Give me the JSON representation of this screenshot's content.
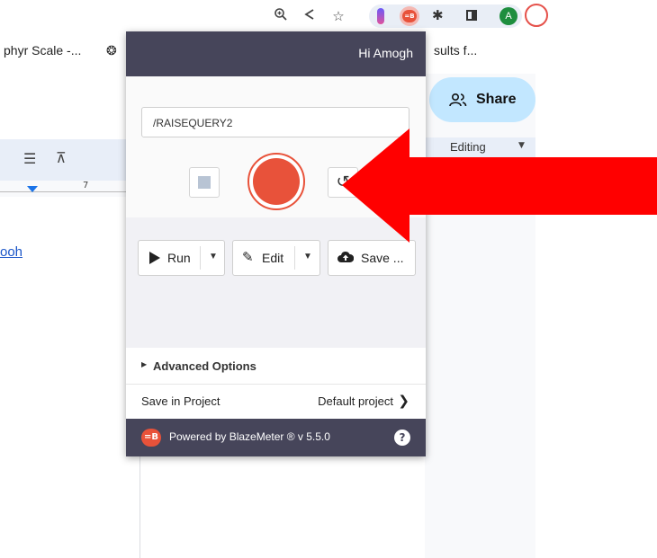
{
  "browser": {
    "icons": [
      "zoom-icon",
      "share-icon",
      "star-icon",
      "extension-icon",
      "blazemeter-extension-icon",
      "puzzle-icon",
      "sidepanel-icon"
    ],
    "avatar_letter": "A"
  },
  "bookmarks": {
    "item1": "phyr Scale -...",
    "item2": "sults f..."
  },
  "doc": {
    "share_label": "Share",
    "ruler_number": "7",
    "link_text": "ooh",
    "editing_label": "Editing"
  },
  "popup": {
    "greeting": "Hi Amogh",
    "test_name": "/RAISEQUERY2",
    "buttons": {
      "run": "Run",
      "edit": "Edit",
      "save": "Save ..."
    },
    "advanced_options": "Advanced Options",
    "save_in_project_label": "Save in Project",
    "project_value": "Default project",
    "footer_text": "Powered by BlazeMeter ® v 5.5.0",
    "logo_text": "=B"
  },
  "colors": {
    "header_bg": "#46455a",
    "record": "#e8523a",
    "arrow": "#ff0000",
    "share_bg": "#c2e7ff"
  }
}
